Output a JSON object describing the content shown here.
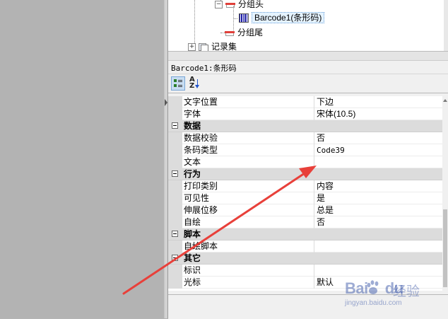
{
  "tree": {
    "items": [
      {
        "label": "分组头",
        "icon": "group-header-icon"
      },
      {
        "label": "Barcode1(条形码)",
        "icon": "barcode-icon",
        "selected": true
      },
      {
        "label": "分组尾",
        "icon": "group-footer-icon"
      },
      {
        "label": "记录集",
        "icon": "recordset-icon",
        "expander": "+"
      }
    ]
  },
  "object_title": "Barcode1:条形码",
  "toolbar": {
    "categorized_button": "categorized-view-icon",
    "alphabetical_button": "sort-az-icon",
    "az_glyph_top": "A",
    "az_glyph_bottom": "Z"
  },
  "properties": [
    {
      "type": "prop",
      "name": "文字位置",
      "value": "下边"
    },
    {
      "type": "prop",
      "name": "字体",
      "value": "宋体(10.5)"
    },
    {
      "type": "category",
      "name": "数据"
    },
    {
      "type": "prop",
      "name": "数据校验",
      "value": "否"
    },
    {
      "type": "prop",
      "name": "条码类型",
      "value": "Code39",
      "mono": true
    },
    {
      "type": "prop",
      "name": "文本",
      "value": ""
    },
    {
      "type": "category",
      "name": "行为"
    },
    {
      "type": "prop",
      "name": "打印类别",
      "value": "内容"
    },
    {
      "type": "prop",
      "name": "可见性",
      "value": "是"
    },
    {
      "type": "prop",
      "name": "伸展位移",
      "value": "总是"
    },
    {
      "type": "prop",
      "name": "自绘",
      "value": "否"
    },
    {
      "type": "category",
      "name": "脚本"
    },
    {
      "type": "prop",
      "name": "自绘脚本",
      "value": ""
    },
    {
      "type": "category",
      "name": "其它"
    },
    {
      "type": "prop",
      "name": "标识",
      "value": ""
    },
    {
      "type": "prop",
      "name": "光标",
      "value": "默认"
    }
  ],
  "watermark": {
    "brand": "Bai",
    "brand2": "du",
    "experience": "经验",
    "url": "jingyan.baidu.com"
  },
  "colors": {
    "annotation_arrow": "#e8403a",
    "category_bg": "#dcdcdc",
    "selection": "#e5f3ff"
  }
}
